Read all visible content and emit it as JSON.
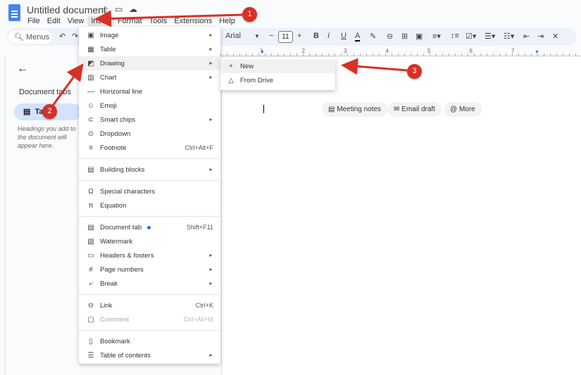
{
  "header": {
    "title": "Untitled document",
    "icons": [
      "star-icon",
      "move-to-folder-icon",
      "cloud-saved-icon"
    ]
  },
  "menubar": [
    "File",
    "Edit",
    "View",
    "Insert",
    "Format",
    "Tools",
    "Extensions",
    "Help"
  ],
  "toolbar": {
    "search": "Menus",
    "font": "Arial",
    "font_size": "11",
    "ruler_numbers": [
      "1",
      "2",
      "3",
      "4",
      "5",
      "6",
      "7"
    ]
  },
  "sidebar": {
    "heading": "Document tabs",
    "tab": "Tab 1",
    "hint": "Headings you add to the document will appear here."
  },
  "chips": [
    "Meeting notes",
    "Email draft",
    "More"
  ],
  "insert_menu": [
    {
      "label": "Image",
      "icon": "image-icon",
      "submenu": true
    },
    {
      "label": "Table",
      "icon": "table-icon",
      "submenu": true
    },
    {
      "label": "Drawing",
      "icon": "drawing-icon",
      "submenu": true,
      "highlighted": true
    },
    {
      "label": "Chart",
      "icon": "chart-icon",
      "submenu": true
    },
    {
      "label": "Horizontal line",
      "icon": "horizontal-line-icon"
    },
    {
      "label": "Emoji",
      "icon": "emoji-icon"
    },
    {
      "label": "Smart chips",
      "icon": "smart-chips-icon",
      "submenu": true
    },
    {
      "label": "Dropdown",
      "icon": "dropdown-icon"
    },
    {
      "label": "Footnote",
      "icon": "footnote-icon",
      "shortcut": "Ctrl+Alt+F"
    },
    {
      "sep": true
    },
    {
      "label": "Building blocks",
      "icon": "building-blocks-icon",
      "submenu": true
    },
    {
      "sep": true
    },
    {
      "label": "Special characters",
      "icon": "omega-icon"
    },
    {
      "label": "Equation",
      "icon": "pi-icon"
    },
    {
      "sep": true
    },
    {
      "label": "Document tab",
      "icon": "document-tab-icon",
      "shortcut": "Shift+F11",
      "dot": true
    },
    {
      "label": "Watermark",
      "icon": "watermark-icon"
    },
    {
      "label": "Headers & footers",
      "icon": "headers-footers-icon",
      "submenu": true
    },
    {
      "label": "Page numbers",
      "icon": "hash-icon",
      "submenu": true
    },
    {
      "label": "Break",
      "icon": "break-icon",
      "submenu": true
    },
    {
      "sep": true
    },
    {
      "label": "Link",
      "icon": "link-icon",
      "shortcut": "Ctrl+K"
    },
    {
      "label": "Comment",
      "icon": "comment-icon",
      "shortcut": "Ctrl+Alt+M",
      "disabled": true
    },
    {
      "sep": true
    },
    {
      "label": "Bookmark",
      "icon": "bookmark-icon"
    },
    {
      "label": "Table of contents",
      "icon": "table-of-contents-icon",
      "submenu": true
    }
  ],
  "drawing_submenu": [
    {
      "label": "New",
      "icon": "plus-icon"
    },
    {
      "label": "From Drive",
      "icon": "drive-icon"
    }
  ],
  "annotations": {
    "color": "#d93025",
    "badges": [
      "1",
      "2",
      "3"
    ]
  }
}
